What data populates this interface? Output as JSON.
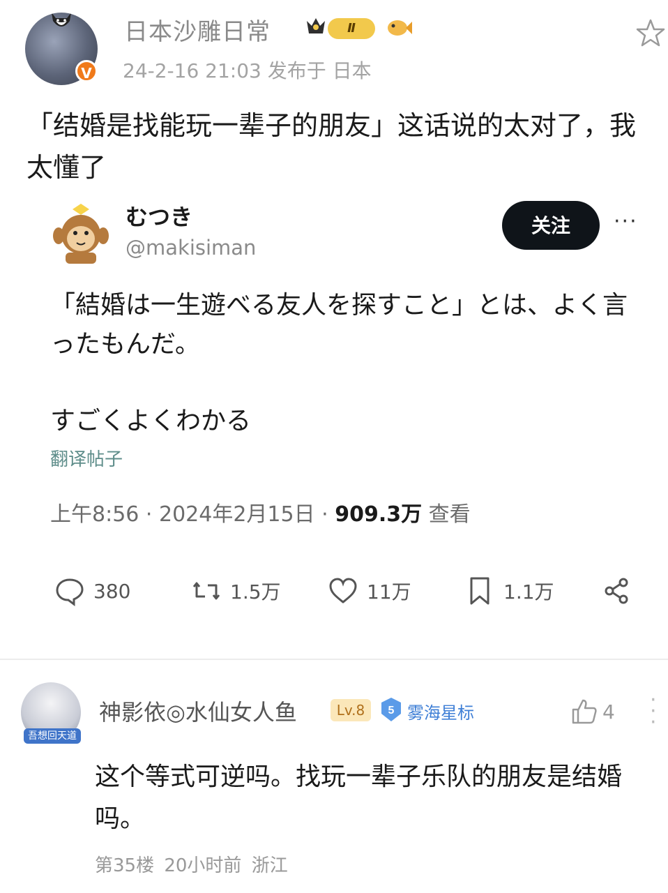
{
  "post": {
    "author": "日本沙雕日常",
    "level_badge": "Ⅱ",
    "meta": "24-2-16 21:03  发布于 日本",
    "text": "「结婚是找能玩一辈子的朋友」这话说的太对了，我太懂了",
    "verified_mark": "V"
  },
  "tweet": {
    "display_name": "むつき",
    "handle": "@makisiman",
    "follow_label": "关注",
    "more_label": "···",
    "body_line1": "「結婚は一生遊べる友人を探すこと」とは、よく言ったもんだ。",
    "body_line2": "すごくよくわかる",
    "translate_label": "翻译帖子",
    "time": "上午8:56 · 2024年2月15日 · ",
    "views_count": "909.3万",
    "views_label": " 查看",
    "actions": {
      "replies": "380",
      "retweets": "1.5万",
      "likes": "11万",
      "bookmarks": "1.1万"
    }
  },
  "comment": {
    "user": "神影依◎水仙女人鱼",
    "avatar_tag": "吾想回天道",
    "level": "Lv.8",
    "medal_number": "5",
    "medal_text": "雾海星标",
    "likes": "4",
    "text": "这个等式可逆吗。找玩一辈子乐队的朋友是结婚吗。",
    "meta": "第35楼  20小时前  浙江"
  },
  "colors": {
    "accent_orange": "#f07a1a",
    "follow_bg": "#0f1419",
    "translate_link": "#5e8d8a",
    "level_gold": "#f2c94c",
    "medal_blue": "#3f7fd6"
  }
}
